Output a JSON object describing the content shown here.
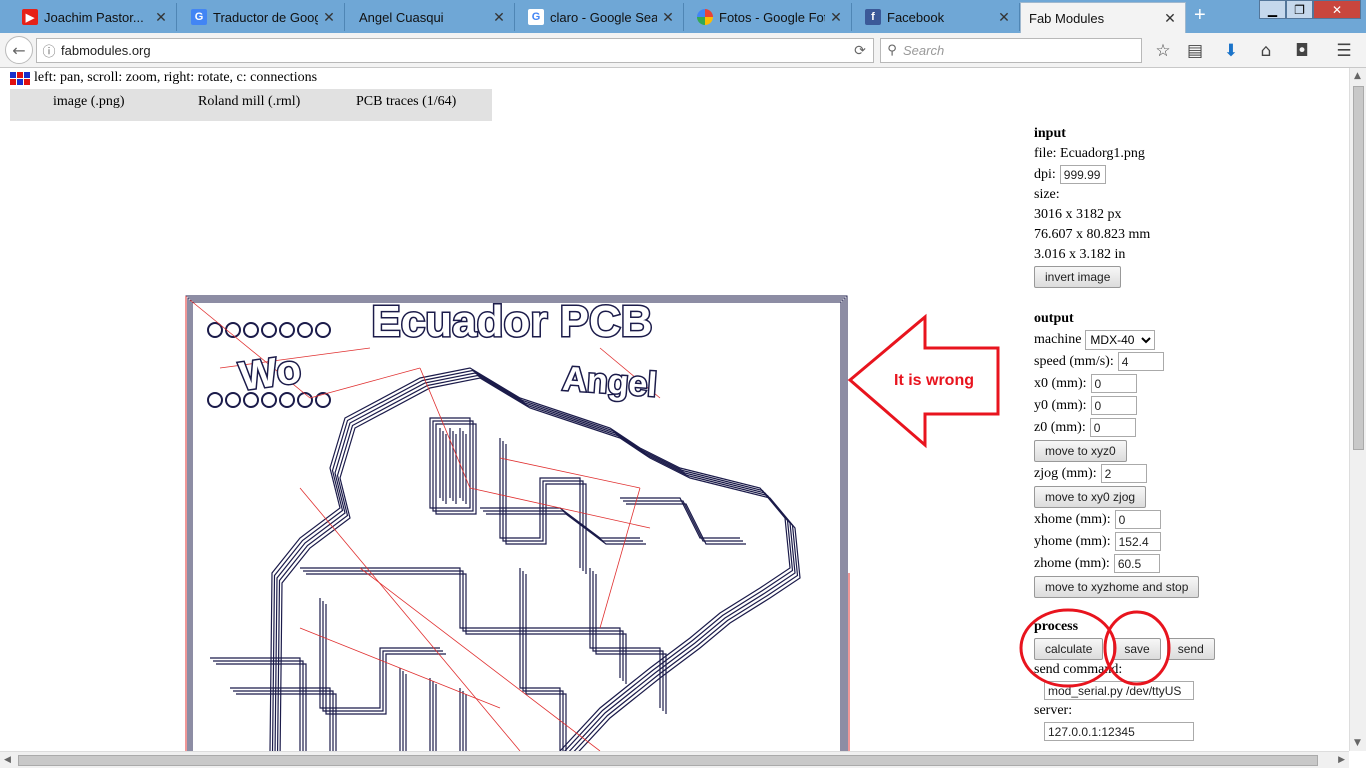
{
  "tabs": [
    {
      "title": "Joachim Pastor...",
      "icon": "youtube-icon",
      "color": "#e62117"
    },
    {
      "title": "Traductor de Google",
      "icon": "google-translate-icon",
      "color": "#4285f4"
    },
    {
      "title": "Angel Cuasqui",
      "icon": "",
      "color": ""
    },
    {
      "title": "claro - Google Sear...",
      "icon": "google-icon",
      "color": "#4285f4"
    },
    {
      "title": "Fotos - Google Fot...",
      "icon": "google-photos-icon",
      "color": "#fbbc05"
    },
    {
      "title": "Facebook",
      "icon": "facebook-icon",
      "color": "#3b5998"
    },
    {
      "title": "Fab Modules",
      "icon": "",
      "color": "",
      "active": true
    }
  ],
  "browser": {
    "url": "fabmodules.org",
    "search_placeholder": "Search"
  },
  "page": {
    "help_text": "left: pan, scroll: zoom, right: rotate, c: connections",
    "menu": [
      "image (.png)",
      "Roland mill (.rml)",
      "PCB traces (1/64)"
    ],
    "input": {
      "heading": "input",
      "file_label": "file: Ecuadorg1.png",
      "dpi_label": "dpi:",
      "dpi_value": "999.99",
      "size_label": "size:",
      "size_px": "3016 x 3182 px",
      "size_mm": "76.607 x 80.823 mm",
      "size_in": "3.016 x 3.182 in",
      "invert_button": "invert image"
    },
    "output": {
      "heading": "output",
      "machine_label": "machine",
      "machine_value": "MDX-40",
      "speed_label": "speed (mm/s):",
      "speed_value": "4",
      "x0_label": "x0 (mm):",
      "x0_value": "0",
      "y0_label": "y0 (mm):",
      "y0_value": "0",
      "z0_label": "z0 (mm):",
      "z0_value": "0",
      "move_xyz0_button": "move to xyz0",
      "zjog_label": "zjog (mm):",
      "zjog_value": "2",
      "move_xy0_zjog_button": "move to xy0 zjog",
      "xhome_label": "xhome (mm):",
      "xhome_value": "0",
      "yhome_label": "yhome (mm):",
      "yhome_value": "152.4",
      "zhome_label": "zhome (mm):",
      "zhome_value": "60.5",
      "move_home_button": "move to xyzhome and stop"
    },
    "process": {
      "heading": "process",
      "calculate_button": "calculate",
      "save_button": "save",
      "send_button": "send",
      "send_command_label": "send command:",
      "send_command_value": "mod_serial.py /dev/ttyUS",
      "server_label": "server:",
      "server_value": "127.0.0.1:12345"
    }
  },
  "annotation": {
    "text": "It is wrong",
    "color": "#e8141e"
  },
  "pcb_text": {
    "title": "Ecuador PCB",
    "name": "Angel",
    "left_word": "Wo"
  }
}
